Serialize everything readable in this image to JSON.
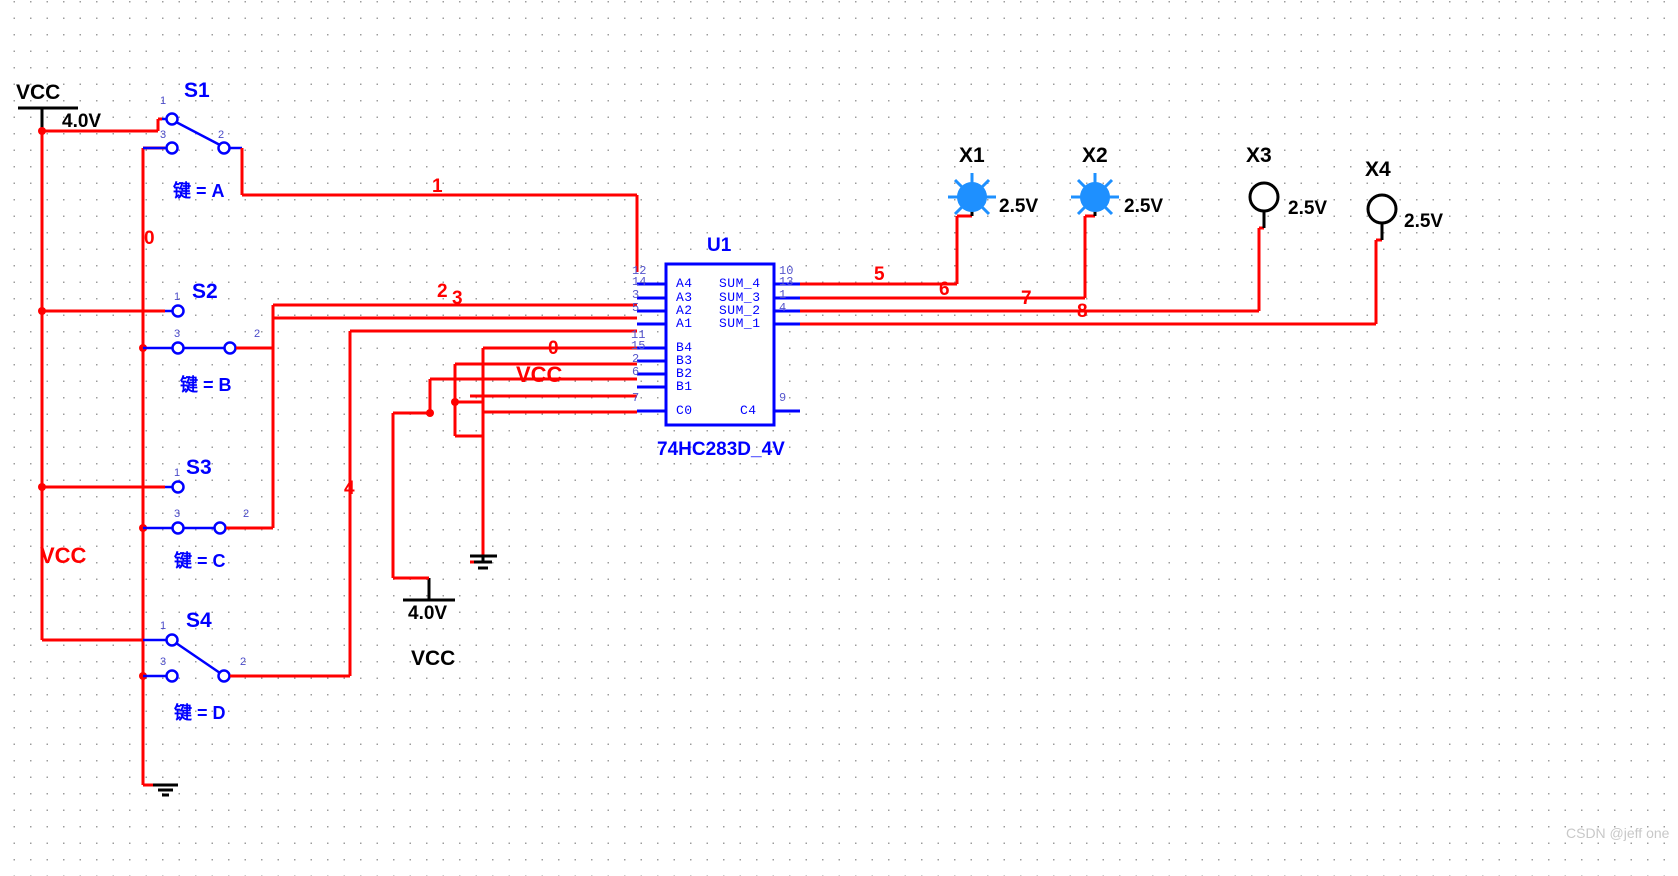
{
  "document": {
    "type": "circuit-schematic",
    "watermark": "CSDN @jeff one"
  },
  "ic": {
    "reference": "U1",
    "part_number": "74HC283D_4V",
    "left_pins": [
      {
        "name": "A4",
        "number": "14"
      },
      {
        "name": "A3",
        "number": "3"
      },
      {
        "name": "A2",
        "number": "5"
      },
      {
        "name": "A1",
        "number": ""
      },
      {
        "name": "B4",
        "number": "15"
      },
      {
        "name": "B3",
        "number": "2"
      },
      {
        "name": "B2",
        "number": "6"
      },
      {
        "name": "B1",
        "number": ""
      },
      {
        "name": "C0",
        "number": ""
      }
    ],
    "left_pin_markers": [
      "12",
      "11",
      "7"
    ],
    "right_pins": [
      {
        "name": "SUM_4",
        "number": "13"
      },
      {
        "name": "SUM_3",
        "number": "1"
      },
      {
        "name": "SUM_2",
        "number": "4"
      },
      {
        "name": "SUM_1",
        "number": ""
      },
      {
        "name": "C4",
        "number": ""
      }
    ],
    "right_pin_markers": [
      "10",
      "9"
    ]
  },
  "switches": [
    {
      "reference": "S1",
      "key_label": "键 = A",
      "terminals": [
        "1",
        "3",
        "2"
      ],
      "position": "up"
    },
    {
      "reference": "S2",
      "key_label": "键 = B",
      "terminals": [
        "1",
        "3",
        "2"
      ],
      "position": "down"
    },
    {
      "reference": "S3",
      "key_label": "键 = C",
      "terminals": [
        "1",
        "3",
        "2"
      ],
      "position": "down"
    },
    {
      "reference": "S4",
      "key_label": "键 = D",
      "terminals": [
        "1",
        "3",
        "2"
      ],
      "position": "up"
    }
  ],
  "lamps": [
    {
      "reference": "X1",
      "voltage": "2.5V",
      "state": "on"
    },
    {
      "reference": "X2",
      "voltage": "2.5V",
      "state": "on"
    },
    {
      "reference": "X3",
      "voltage": "2.5V",
      "state": "off"
    },
    {
      "reference": "X4",
      "voltage": "2.5V",
      "state": "off"
    }
  ],
  "sources": [
    {
      "name": "VCC",
      "voltage": "4.0V",
      "location": "top-left"
    },
    {
      "name": "VCC",
      "voltage": "4.0V",
      "location": "bottom-middle"
    }
  ],
  "labels": {
    "vcc_top": "VCC",
    "vcc_top_voltage": "4.0V",
    "vcc_left_red": "VCC",
    "vcc_mid_red": "VCC",
    "vcc_bottom_voltage": "4.0V",
    "vcc_bottom": "VCC"
  },
  "nets": [
    {
      "id": "n0a",
      "label": "0"
    },
    {
      "id": "n1",
      "label": "1"
    },
    {
      "id": "n2",
      "label": "2"
    },
    {
      "id": "n3",
      "label": "3"
    },
    {
      "id": "n4",
      "label": "4"
    },
    {
      "id": "n0b",
      "label": "0"
    },
    {
      "id": "n5",
      "label": "5"
    },
    {
      "id": "n6",
      "label": "6"
    },
    {
      "id": "n7",
      "label": "7"
    },
    {
      "id": "n8",
      "label": "8"
    }
  ],
  "colors": {
    "wire_red": "#ff0000",
    "component_blue": "#0000ff",
    "lamp_on": "#1e90ff",
    "lamp_off": "#000000",
    "black": "#000000"
  }
}
